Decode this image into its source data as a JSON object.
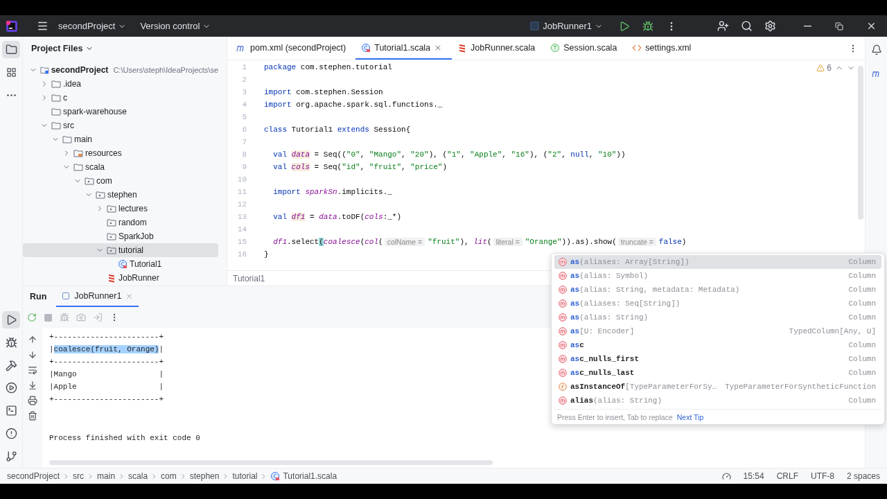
{
  "title_bar": {
    "project": "secondProject",
    "vcs": "Version control",
    "run_config": "JobRunner1"
  },
  "project_panel": {
    "title": "Project Files",
    "tree": [
      {
        "label": "secondProject",
        "path": "C:\\Users\\steph\\IdeaProjects\\se",
        "kind": "module",
        "expanded": true,
        "selected": false,
        "children": [
          {
            "label": ".idea",
            "kind": "folder",
            "expanded": false,
            "selected": false
          },
          {
            "label": "c",
            "kind": "folder",
            "expanded": false,
            "selected": false
          },
          {
            "label": "spark-warehouse",
            "kind": "folder",
            "selected": false
          },
          {
            "label": "src",
            "kind": "folder",
            "expanded": true,
            "selected": false,
            "children": [
              {
                "label": "main",
                "kind": "folder",
                "expanded": true,
                "selected": false,
                "children": [
                  {
                    "label": "resources",
                    "kind": "resources",
                    "expanded": false,
                    "selected": false
                  },
                  {
                    "label": "scala",
                    "kind": "folder",
                    "expanded": true,
                    "selected": false,
                    "children": [
                      {
                        "label": "com",
                        "kind": "package",
                        "expanded": true,
                        "selected": false,
                        "children": [
                          {
                            "label": "stephen",
                            "kind": "package",
                            "expanded": true,
                            "selected": false,
                            "children": [
                              {
                                "label": "lectures",
                                "kind": "package",
                                "expanded": false,
                                "selected": false
                              },
                              {
                                "label": "random",
                                "kind": "package",
                                "selected": false
                              },
                              {
                                "label": "SparkJob",
                                "kind": "package",
                                "selected": false
                              },
                              {
                                "label": "tutorial",
                                "kind": "package",
                                "expanded": true,
                                "selected": true,
                                "children": [
                                  {
                                    "label": "Tutorial1",
                                    "kind": "class",
                                    "selected": false
                                  }
                                ]
                              },
                              {
                                "label": "JobRunner",
                                "kind": "object",
                                "selected": false
                              }
                            ]
                          }
                        ]
                      }
                    ]
                  }
                ]
              }
            ]
          }
        ]
      }
    ]
  },
  "editor": {
    "tabs": [
      {
        "label": "pom.xml (secondProject)",
        "kind": "maven",
        "selected": false
      },
      {
        "label": "Tutorial1.scala",
        "kind": "class",
        "selected": true
      },
      {
        "label": "JobRunner.scala",
        "kind": "object",
        "selected": false
      },
      {
        "label": "Session.scala",
        "kind": "trait",
        "selected": false
      },
      {
        "label": "settings.xml",
        "kind": "xml",
        "selected": false
      }
    ],
    "warnings": "6",
    "lines": [
      {
        "number": "1",
        "tokens": [
          {
            "text": "package",
            "kind": "kw"
          },
          {
            "text": " com.stephen.tutorial",
            "kind": "plain"
          }
        ]
      },
      {
        "number": "2"
      },
      {
        "number": "3",
        "tokens": [
          {
            "text": "import",
            "kind": "kw"
          },
          {
            "text": " com.stephen.Session",
            "kind": "plain"
          }
        ]
      },
      {
        "number": "4",
        "tokens": [
          {
            "text": "import",
            "kind": "kw"
          },
          {
            "text": " org.apache.spark.sql.functions._",
            "kind": "plain"
          }
        ]
      },
      {
        "number": "5"
      },
      {
        "number": "6",
        "tokens": [
          {
            "text": "class",
            "kind": "kw"
          },
          {
            "text": " Tutorial1 ",
            "kind": "plain"
          },
          {
            "text": "extends",
            "kind": "kw"
          },
          {
            "text": " Session{",
            "kind": "plain"
          }
        ]
      },
      {
        "number": "7"
      },
      {
        "number": "8",
        "tokens": [
          {
            "text": "  val ",
            "kind": "kw"
          },
          {
            "text": "data",
            "kind": "decl"
          },
          {
            "text": " = Seq((",
            "kind": "plain"
          },
          {
            "text": "\"0\"",
            "kind": "str"
          },
          {
            "text": ", ",
            "kind": "plain"
          },
          {
            "text": "\"Mango\"",
            "kind": "str"
          },
          {
            "text": ", ",
            "kind": "plain"
          },
          {
            "text": "\"20\"",
            "kind": "str"
          },
          {
            "text": "), (",
            "kind": "plain"
          },
          {
            "text": "\"1\"",
            "kind": "str"
          },
          {
            "text": ", ",
            "kind": "plain"
          },
          {
            "text": "\"Apple\"",
            "kind": "str"
          },
          {
            "text": ", ",
            "kind": "plain"
          },
          {
            "text": "\"16\"",
            "kind": "str"
          },
          {
            "text": "), (",
            "kind": "plain"
          },
          {
            "text": "\"2\"",
            "kind": "str"
          },
          {
            "text": ", ",
            "kind": "plain"
          },
          {
            "text": "null",
            "kind": "kw"
          },
          {
            "text": ", ",
            "kind": "plain"
          },
          {
            "text": "\"10\"",
            "kind": "str"
          },
          {
            "text": "))",
            "kind": "plain"
          }
        ]
      },
      {
        "number": "9",
        "tokens": [
          {
            "text": "  val ",
            "kind": "kw"
          },
          {
            "text": "cols",
            "kind": "decl"
          },
          {
            "text": " = Seq(",
            "kind": "plain"
          },
          {
            "text": "\"id\"",
            "kind": "str"
          },
          {
            "text": ", ",
            "kind": "plain"
          },
          {
            "text": "\"fruit\"",
            "kind": "str"
          },
          {
            "text": ", ",
            "kind": "plain"
          },
          {
            "text": "\"price\"",
            "kind": "str"
          },
          {
            "text": ")",
            "kind": "plain"
          }
        ]
      },
      {
        "number": "10"
      },
      {
        "number": "11",
        "tokens": [
          {
            "text": "  import ",
            "kind": "kw"
          },
          {
            "text": "sparkSn",
            "kind": "ital"
          },
          {
            "text": ".implicits._",
            "kind": "plain"
          }
        ]
      },
      {
        "number": "12"
      },
      {
        "number": "13",
        "tokens": [
          {
            "text": "  val ",
            "kind": "kw"
          },
          {
            "text": "df1",
            "kind": "decl"
          },
          {
            "text": " = ",
            "kind": "plain"
          },
          {
            "text": "data",
            "kind": "ital"
          },
          {
            "text": ".toDF(",
            "kind": "plain"
          },
          {
            "text": "cols",
            "kind": "ital"
          },
          {
            "text": ":_*)",
            "kind": "plain"
          }
        ]
      },
      {
        "number": "14"
      },
      {
        "number": "15",
        "tokens": [
          {
            "text": "  df1",
            "kind": "ital"
          },
          {
            "text": ".select",
            "kind": "plain"
          },
          {
            "text": "(",
            "kind": "brace"
          },
          {
            "text": "coalesce",
            "kind": "ital"
          },
          {
            "text": "(",
            "kind": "plain"
          },
          {
            "text": "col",
            "kind": "ital"
          },
          {
            "text": "(",
            "kind": "plain"
          },
          {
            "text": "colName =",
            "kind": "hint"
          },
          {
            "text": "\"fruit\"",
            "kind": "str"
          },
          {
            "text": "), ",
            "kind": "plain"
          },
          {
            "text": "lit",
            "kind": "ital"
          },
          {
            "text": "(",
            "kind": "plain"
          },
          {
            "text": "literal =",
            "kind": "hint"
          },
          {
            "text": "\"Orange\"",
            "kind": "str"
          },
          {
            "text": ")).as",
            "kind": "plain"
          },
          {
            "text": ").show(",
            "kind": "plain"
          },
          {
            "text": "truncate =",
            "kind": "hint"
          },
          {
            "text": "false",
            "kind": "kw"
          },
          {
            "text": ")",
            "kind": "plain"
          }
        ]
      },
      {
        "number": "16",
        "tokens": [
          {
            "text": "}",
            "kind": "plain"
          }
        ]
      }
    ],
    "breadcrumb": "Tutorial1"
  },
  "completion": {
    "items": [
      {
        "kind": "method",
        "selected": true,
        "parts": [
          {
            "text": "as",
            "kind": "match"
          },
          {
            "text": "(aliases: Array[String])",
            "kind": "params"
          }
        ],
        "type": "Column"
      },
      {
        "kind": "method",
        "selected": false,
        "parts": [
          {
            "text": "as",
            "kind": "match"
          },
          {
            "text": "(alias: Symbol)",
            "kind": "params"
          }
        ],
        "type": "Column"
      },
      {
        "kind": "method",
        "selected": false,
        "parts": [
          {
            "text": "as",
            "kind": "match"
          },
          {
            "text": "(alias: String, metadata: Metadata)",
            "kind": "params"
          }
        ],
        "type": "Column"
      },
      {
        "kind": "method",
        "selected": false,
        "parts": [
          {
            "text": "as",
            "kind": "match"
          },
          {
            "text": "(aliases: Seq[String])",
            "kind": "params"
          }
        ],
        "type": "Column"
      },
      {
        "kind": "method",
        "selected": false,
        "parts": [
          {
            "text": "as",
            "kind": "match"
          },
          {
            "text": "(alias: String)",
            "kind": "params"
          }
        ],
        "type": "Column"
      },
      {
        "kind": "method",
        "selected": false,
        "parts": [
          {
            "text": "as",
            "kind": "match"
          },
          {
            "text": "[U: Encoder]",
            "kind": "params"
          }
        ],
        "type": "TypedColumn[Any, U]"
      },
      {
        "kind": "method",
        "selected": false,
        "parts": [
          {
            "text": "as",
            "kind": "match"
          },
          {
            "text": "c",
            "kind": "name"
          }
        ],
        "type": "Column"
      },
      {
        "kind": "method",
        "selected": false,
        "parts": [
          {
            "text": "as",
            "kind": "match"
          },
          {
            "text": "c_nulls_first",
            "kind": "name"
          }
        ],
        "type": "Column"
      },
      {
        "kind": "method",
        "selected": false,
        "parts": [
          {
            "text": "as",
            "kind": "match"
          },
          {
            "text": "c_nulls_last",
            "kind": "name"
          }
        ],
        "type": "Column"
      },
      {
        "kind": "function",
        "selected": false,
        "parts": [
          {
            "text": "asInstanceOf",
            "kind": "name"
          },
          {
            "text": "[TypeParameterForSy…",
            "kind": "params"
          }
        ],
        "type": "TypeParameterForSyntheticFunction"
      },
      {
        "kind": "method",
        "selected": false,
        "parts": [
          {
            "text": "alias",
            "kind": "name"
          },
          {
            "text": "(alias: String)",
            "kind": "params"
          }
        ],
        "type": "Column"
      }
    ],
    "footer": "Press Enter to insert, Tab to replace",
    "tip_link": "Next Tip"
  },
  "run_panel": {
    "title": "Run",
    "tabs": [
      {
        "label": "JobRunner1",
        "selected": true
      }
    ],
    "console": [
      {
        "kind": "table",
        "segments": [
          {
            "text": "+-----------------------+",
            "selected": false
          }
        ]
      },
      {
        "kind": "table",
        "segments": [
          {
            "text": "|",
            "selected": false
          },
          {
            "text": "coalesce(fruit, Orange)",
            "selected": true
          },
          {
            "text": "|",
            "selected": false
          }
        ]
      },
      {
        "kind": "table",
        "segments": [
          {
            "text": "+-----------------------+",
            "selected": false
          }
        ]
      },
      {
        "kind": "table",
        "segments": [
          {
            "text": "|Mango                  |",
            "selected": false
          }
        ]
      },
      {
        "kind": "table",
        "segments": [
          {
            "text": "|Apple                  |",
            "selected": false
          }
        ]
      },
      {
        "kind": "table",
        "segments": [
          {
            "text": "+-----------------------+",
            "selected": false
          }
        ]
      },
      {
        "kind": "message",
        "segments": [
          {
            "text": "Process finished with exit code 0",
            "selected": false
          }
        ]
      }
    ]
  },
  "status_bar": {
    "breadcrumbs": [
      "secondProject",
      "src",
      "main",
      "scala",
      "com",
      "stephen",
      "tutorial",
      "Tutorial1.scala"
    ],
    "position": "15:54",
    "line_ending": "CRLF",
    "encoding": "UTF-8",
    "indent": "2 spaces"
  }
}
